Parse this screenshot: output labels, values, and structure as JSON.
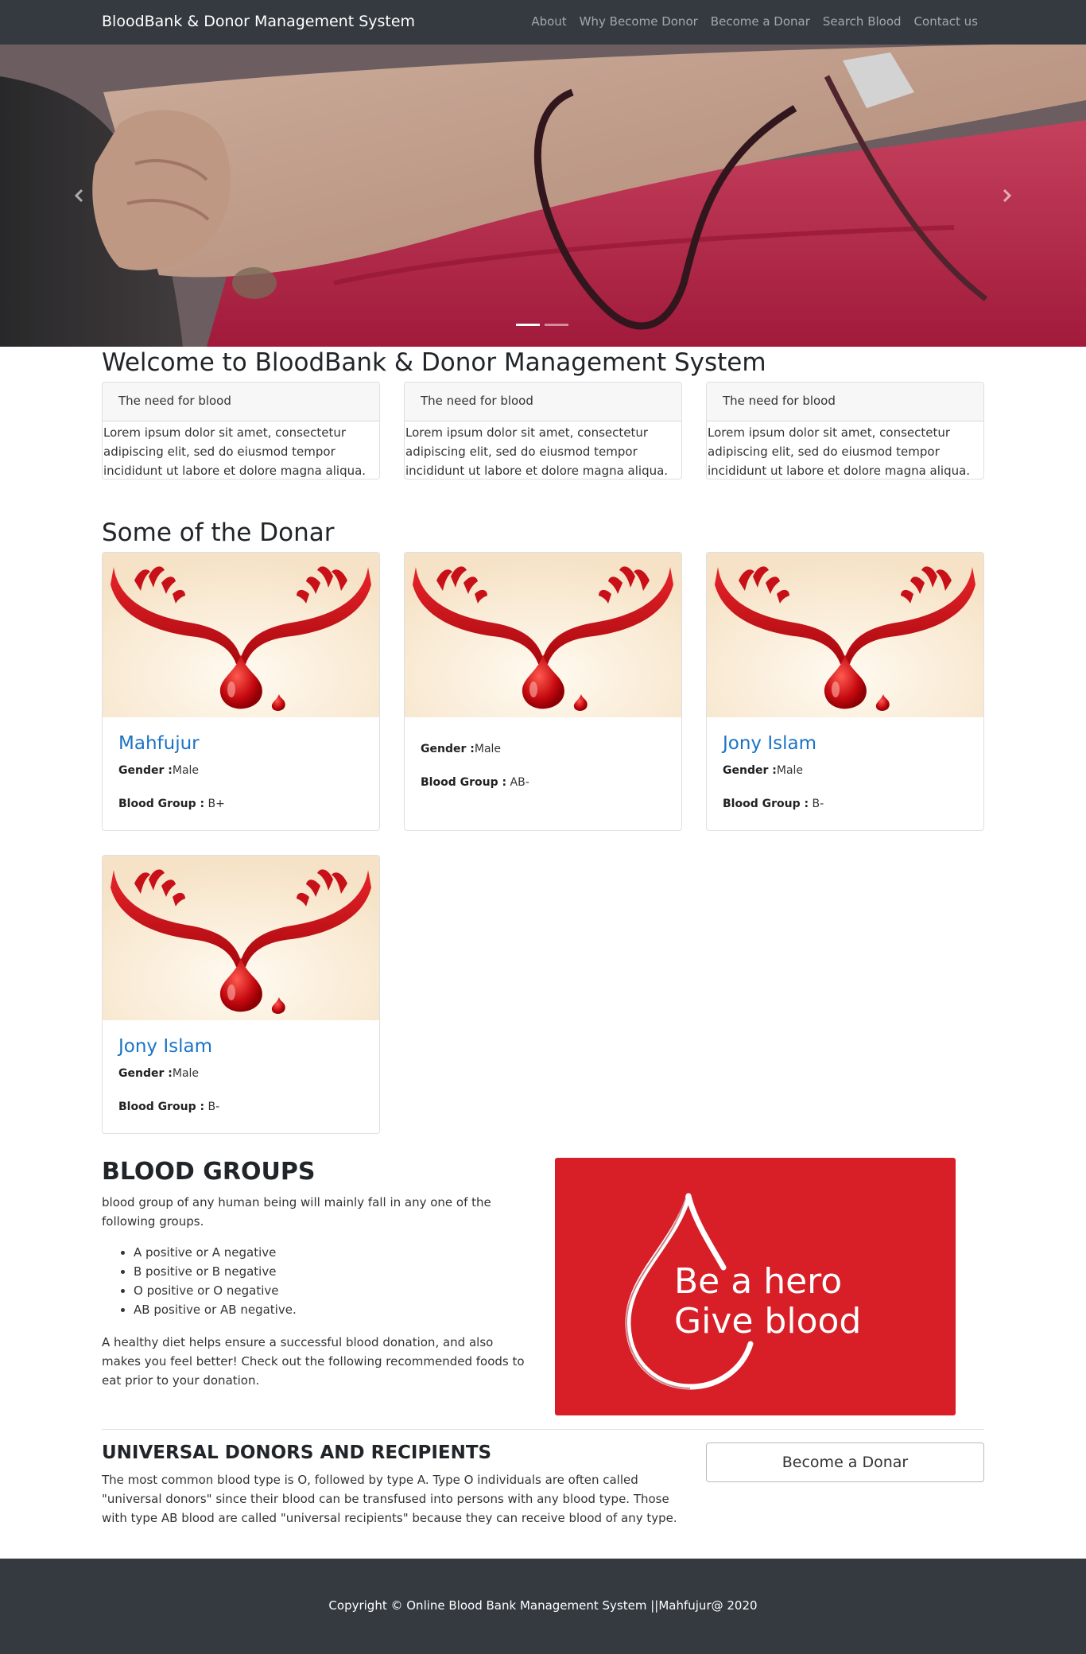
{
  "navbar": {
    "brand": "BloodBank & Donor Management System",
    "links": [
      "About",
      "Why Become Donor",
      "Become a Donar",
      "Search Blood",
      "Contact us"
    ]
  },
  "carousel": {
    "icons": [
      "chevron-left-icon",
      "chevron-right-icon"
    ],
    "slides": 2,
    "active_index": 0
  },
  "welcome": {
    "title": "Welcome to BloodBank & Donor Management System",
    "cards": [
      {
        "heading": "The need for blood",
        "body": "Lorem ipsum dolor sit amet, consectetur adipiscing elit, sed do eiusmod tempor incididunt ut labore et dolore magna aliqua."
      },
      {
        "heading": "The need for blood",
        "body": "Lorem ipsum dolor sit amet, consectetur adipiscing elit, sed do eiusmod tempor incididunt ut labore et dolore magna aliqua."
      },
      {
        "heading": "The need for blood",
        "body": "Lorem ipsum dolor sit amet, consectetur adipiscing elit, sed do eiusmod tempor incididunt ut labore et dolore magna aliqua."
      }
    ]
  },
  "donors": {
    "title": "Some of the Donar",
    "gender_label": "Gender :",
    "blood_label": "Blood Group :",
    "items": [
      {
        "name": "Mahfujur",
        "gender": "Male",
        "blood_group": "B+"
      },
      {
        "name": "",
        "gender": "Male",
        "blood_group": "AB-"
      },
      {
        "name": "Jony Islam",
        "gender": "Male",
        "blood_group": "B-"
      },
      {
        "name": "Jony Islam",
        "gender": "Male",
        "blood_group": "B-"
      }
    ]
  },
  "blood_groups": {
    "title": "BLOOD GROUPS",
    "intro": "blood group of any human being will mainly fall in any one of the following groups.",
    "list": [
      "A positive or A negative",
      "B positive or B negative",
      "O positive or O negative",
      "AB positive or AB negative."
    ],
    "diet": "A healthy diet helps ensure a successful blood donation, and also makes you feel better! Check out the following recommended foods to eat prior to your donation.",
    "banner_line1": "Be a hero",
    "banner_line2": "Give blood",
    "banner_color": "#d81e27"
  },
  "universal": {
    "title": "UNIVERSAL DONORS AND RECIPIENTS",
    "text": "The most common blood type is O, followed by type A. Type O individuals are often called \"universal donors\" since their blood can be transfused into persons with any blood type. Those with type AB blood are called \"universal recipients\" because they can receive blood of any type.",
    "button": "Become a Donar"
  },
  "footer": {
    "text": "Copyright © Online Blood Bank Management System ||Mahfujur@ 2020"
  }
}
